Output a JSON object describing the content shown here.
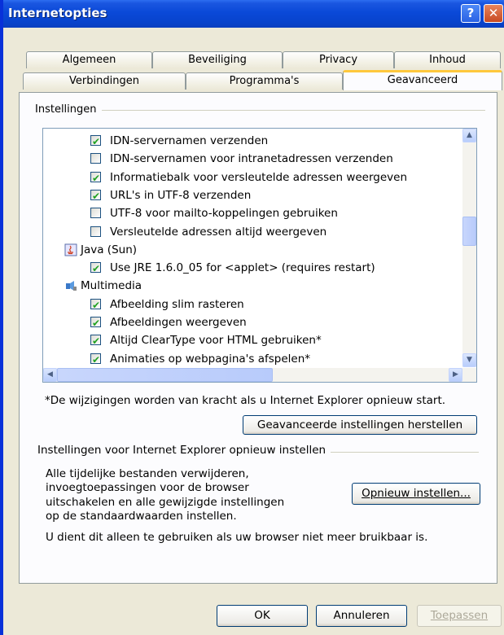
{
  "window": {
    "title": "Internetopties",
    "help_glyph": "?",
    "close_glyph": "✕"
  },
  "tabs_top": [
    "Algemeen",
    "Beveiliging",
    "Privacy",
    "Inhoud"
  ],
  "tabs_bottom": [
    "Verbindingen",
    "Programma's",
    "Geavanceerd"
  ],
  "settings": {
    "group_label": "Instellingen",
    "rows": [
      {
        "type": "checkbox",
        "checked": true,
        "label": "IDN-servernamen verzenden"
      },
      {
        "type": "checkbox",
        "checked": false,
        "label": "IDN-servernamen voor intranetadressen verzenden"
      },
      {
        "type": "checkbox",
        "checked": true,
        "label": "Informatiebalk voor versleutelde adressen weergeven"
      },
      {
        "type": "checkbox",
        "checked": true,
        "label": "URL's in UTF-8 verzenden"
      },
      {
        "type": "checkbox",
        "checked": false,
        "label": "UTF-8 voor mailto-koppelingen gebruiken"
      },
      {
        "type": "checkbox",
        "checked": false,
        "label": "Versleutelde adressen altijd weergeven"
      },
      {
        "type": "category",
        "icon": "java-icon",
        "label": "Java (Sun)"
      },
      {
        "type": "checkbox",
        "checked": true,
        "label": "Use JRE 1.6.0_05 for <applet> (requires restart)"
      },
      {
        "type": "category",
        "icon": "multimedia-icon",
        "label": "Multimedia"
      },
      {
        "type": "checkbox",
        "checked": true,
        "label": "Afbeelding slim rasteren"
      },
      {
        "type": "checkbox",
        "checked": true,
        "label": "Afbeeldingen weergeven"
      },
      {
        "type": "checkbox",
        "checked": true,
        "label": "Altijd ClearType voor HTML gebruiken*"
      },
      {
        "type": "checkbox",
        "checked": true,
        "label": "Animaties op webpagina's afspelen*"
      }
    ]
  },
  "restart_note": "*De wijzigingen worden van kracht als u Internet Explorer opnieuw start.",
  "restore_button": "Geavanceerde instellingen herstellen",
  "reset_group": {
    "label": "Instellingen voor Internet Explorer opnieuw instellen",
    "description_lines": [
      "Alle tijdelijke bestanden verwijderen,",
      "invoegtoepassingen voor de browser",
      "uitschakelen en alle gewijzigde instellingen",
      "op de standaardwaarden instellen."
    ],
    "reset_button": "Opnieuw instellen...",
    "warning": "U dient dit alleen te gebruiken als uw browser niet meer bruikbaar is."
  },
  "footer": {
    "ok": "OK",
    "cancel": "Annuleren",
    "apply": "Toepassen"
  }
}
